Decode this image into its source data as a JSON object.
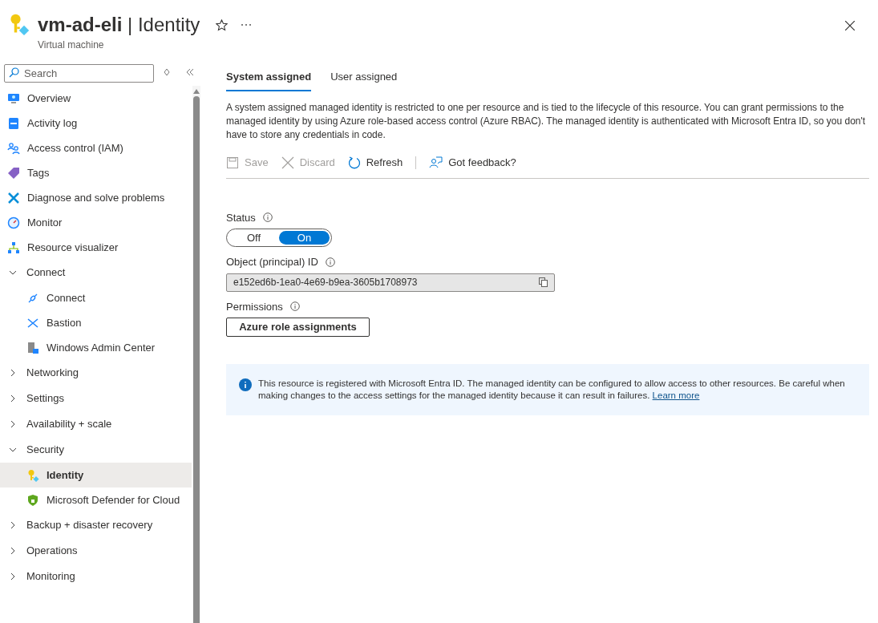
{
  "header": {
    "resource": "vm-ad-eli",
    "separator": "|",
    "page": "Identity",
    "subtitle": "Virtual machine",
    "favorite": false
  },
  "sidebar": {
    "search": {
      "placeholder": "Search"
    },
    "items": [
      {
        "kind": "link",
        "label": "Overview",
        "selected": false
      },
      {
        "kind": "link",
        "label": "Activity log",
        "selected": false
      },
      {
        "kind": "link",
        "label": "Access control (IAM)",
        "selected": false
      },
      {
        "kind": "link",
        "label": "Tags",
        "selected": false
      },
      {
        "kind": "link",
        "label": "Diagnose and solve problems",
        "selected": false
      },
      {
        "kind": "link",
        "label": "Monitor",
        "selected": false
      },
      {
        "kind": "link",
        "label": "Resource visualizer",
        "selected": false
      },
      {
        "kind": "group",
        "label": "Connect",
        "expanded": true,
        "children": [
          {
            "kind": "link",
            "label": "Connect",
            "selected": false
          },
          {
            "kind": "link",
            "label": "Bastion",
            "selected": false
          },
          {
            "kind": "link",
            "label": "Windows Admin Center",
            "selected": false
          }
        ]
      },
      {
        "kind": "group",
        "label": "Networking",
        "expanded": false
      },
      {
        "kind": "group",
        "label": "Settings",
        "expanded": false
      },
      {
        "kind": "group",
        "label": "Availability + scale",
        "expanded": false
      },
      {
        "kind": "group",
        "label": "Security",
        "expanded": true,
        "children": [
          {
            "kind": "link",
            "label": "Identity",
            "selected": true
          },
          {
            "kind": "link",
            "label": "Microsoft Defender for Cloud",
            "selected": false
          }
        ]
      },
      {
        "kind": "group",
        "label": "Backup + disaster recovery",
        "expanded": false
      },
      {
        "kind": "group",
        "label": "Operations",
        "expanded": false
      },
      {
        "kind": "group",
        "label": "Monitoring",
        "expanded": false
      }
    ]
  },
  "tabs": [
    {
      "label": "System assigned",
      "selected": true
    },
    {
      "label": "User assigned",
      "selected": false
    }
  ],
  "description": "A system assigned managed identity is restricted to one per resource and is tied to the lifecycle of this resource. You can grant permissions to the managed identity by using Azure role-based access control (Azure RBAC). The managed identity is authenticated with Microsoft Entra ID, so you don't have to store any credentials in code.",
  "toolbar": [
    {
      "kind": "save",
      "label": "Save",
      "disabled": true
    },
    {
      "kind": "discard",
      "label": "Discard",
      "disabled": true
    },
    {
      "kind": "refresh",
      "label": "Refresh",
      "disabled": false
    },
    {
      "kind": "feedback",
      "label": "Got feedback?",
      "disabled": false
    }
  ],
  "status": {
    "label": "Status",
    "options": [
      {
        "label": "Off",
        "selected": false
      },
      {
        "label": "On",
        "selected": true
      }
    ]
  },
  "object_id": {
    "label": "Object (principal) ID",
    "value": "e152ed6b-1ea0-4e69-b9ea-3605b1708973"
  },
  "permissions": {
    "label": "Permissions",
    "button": "Azure role assignments"
  },
  "info": {
    "text": "This resource is registered with Microsoft Entra ID. The managed identity can be configured to allow access to other resources. Be careful when making changes to the access settings for the managed identity because it can result in failures.",
    "link": "Learn more"
  }
}
